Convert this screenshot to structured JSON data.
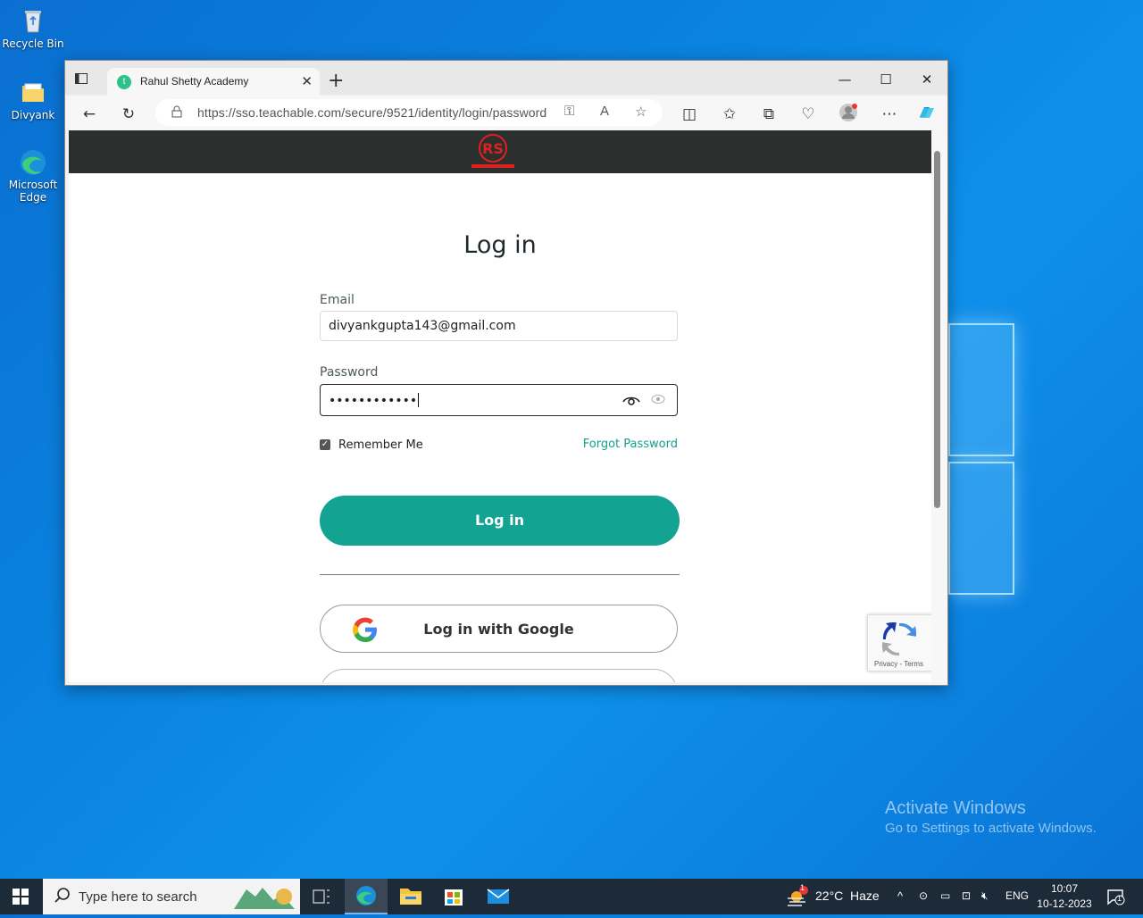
{
  "desktop": {
    "icons": [
      {
        "label": "Recycle Bin"
      },
      {
        "label": "Divyank"
      },
      {
        "label": "Microsoft Edge"
      }
    ],
    "watermark": {
      "line1": "Activate Windows",
      "line2": "Go to Settings to activate Windows."
    }
  },
  "browser": {
    "tab": {
      "favicon": "t",
      "title": "Rahul Shetty Academy"
    },
    "address_bar": {
      "url": "https://sso.teachable.com/secure/9521/identity/login/password"
    }
  },
  "page": {
    "title": "Log in",
    "email": {
      "label": "Email",
      "value": "divyankgupta143@gmail.com"
    },
    "password": {
      "label": "Password",
      "value": "••••••••••••"
    },
    "remember_me": {
      "label": "Remember Me",
      "checked": true
    },
    "forgot_password": "Forgot Password",
    "login_button": "Log in",
    "google_button": "Log in with Google",
    "recaptcha": {
      "privacy": "Privacy",
      "separator": " - ",
      "terms": "Terms"
    }
  },
  "taskbar": {
    "search_placeholder": "Type here to search",
    "weather": {
      "temp": "22°C",
      "condition": "Haze",
      "badge": "1"
    },
    "language": "ENG",
    "time": "10:07",
    "date": "10-12-2023",
    "notification_count": "1"
  },
  "colors": {
    "accent": "#12a392",
    "header_bg": "#2b2f2d",
    "taskbar_bg": "#1d2a37"
  }
}
